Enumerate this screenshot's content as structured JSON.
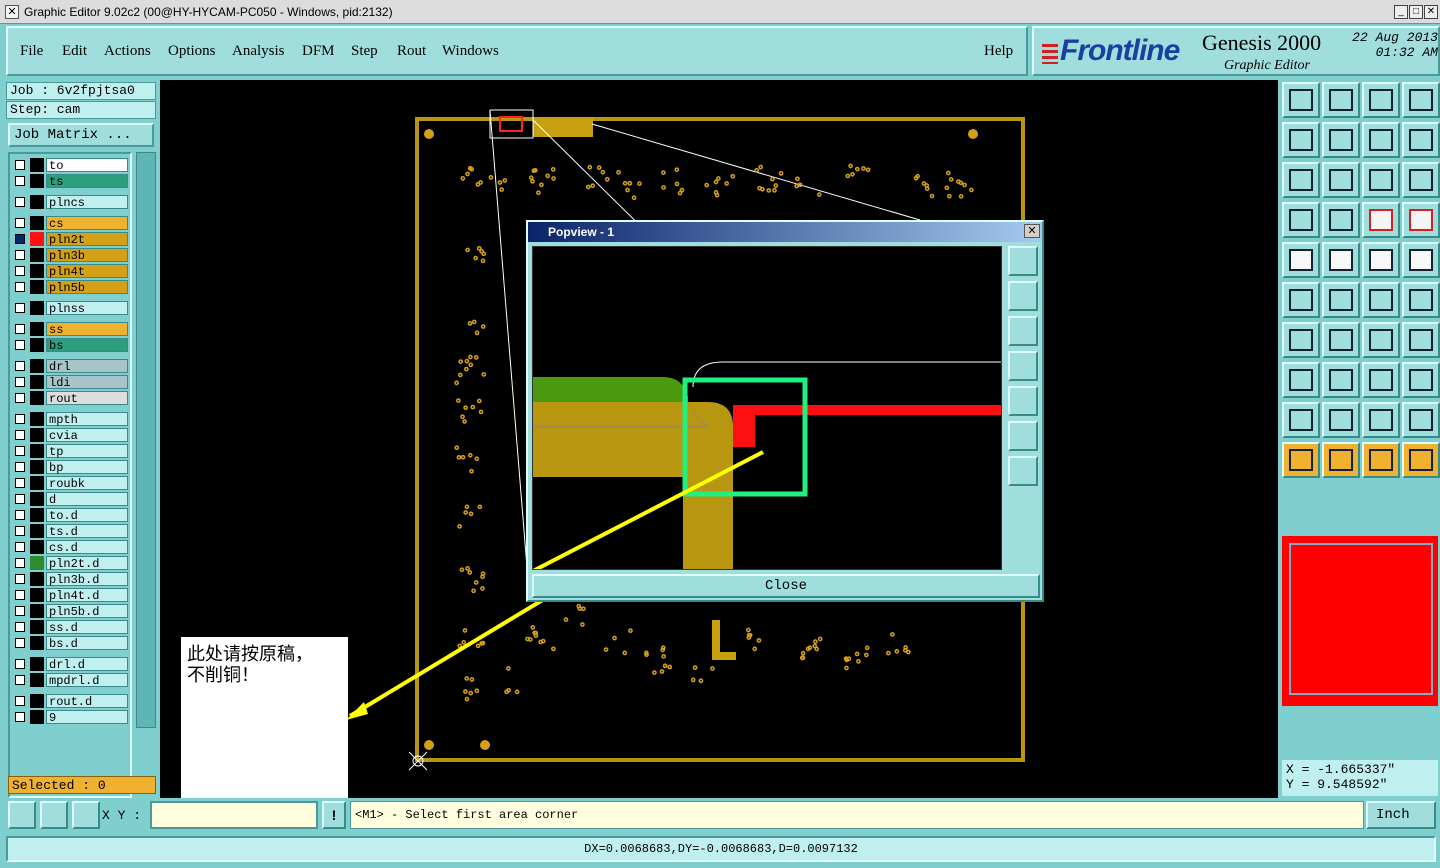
{
  "window": {
    "title": "Graphic Editor 9.02c2 (00@HY-HYCAM-PC050 - Windows, pid:2132)"
  },
  "menu": {
    "items": [
      "File",
      "Edit",
      "Actions",
      "Options",
      "Analysis",
      "DFM",
      "Step",
      "Rout",
      "Windows"
    ],
    "help": "Help"
  },
  "logo": {
    "brand": "Frontline",
    "product": "Genesis 2000",
    "subtitle": "Graphic Editor",
    "date": "22 Aug 2013",
    "time": "01:32 AM"
  },
  "job": {
    "job_label": "Job : 6v2fpjtsa0",
    "step_label": "Step: cam",
    "matrix_button": "Job Matrix ..."
  },
  "layers": [
    {
      "name": "to",
      "color": "#ffffff"
    },
    {
      "name": "ts",
      "color": "#2e9e7e"
    },
    {
      "name": "plncs",
      "color": "#bfefef"
    },
    {
      "name": "cs",
      "color": "#f0b030"
    },
    {
      "name": "pln2t",
      "color": "#d4a017",
      "active": true
    },
    {
      "name": "pln3b",
      "color": "#d4a017"
    },
    {
      "name": "pln4t",
      "color": "#d4a017"
    },
    {
      "name": "pln5b",
      "color": "#d4a017"
    },
    {
      "name": "plnss",
      "color": "#bfefef"
    },
    {
      "name": "ss",
      "color": "#f0b030"
    },
    {
      "name": "bs",
      "color": "#2e9e7e"
    },
    {
      "name": "drl",
      "color": "#a8c4c8"
    },
    {
      "name": "ldi",
      "color": "#a8c4c8"
    },
    {
      "name": "rout",
      "color": "#dddddd"
    },
    {
      "name": "mpth",
      "color": "#bfefef"
    },
    {
      "name": "cvia",
      "color": "#bfefef"
    },
    {
      "name": "tp",
      "color": "#bfefef"
    },
    {
      "name": "bp",
      "color": "#bfefef"
    },
    {
      "name": "roubk",
      "color": "#bfefef"
    },
    {
      "name": "d",
      "color": "#bfefef"
    },
    {
      "name": "to.d",
      "color": "#bfefef"
    },
    {
      "name": "ts.d",
      "color": "#bfefef"
    },
    {
      "name": "cs.d",
      "color": "#bfefef"
    },
    {
      "name": "pln2t.d",
      "color": "#bfefef",
      "marker": "#2e8b2e"
    },
    {
      "name": "pln3b.d",
      "color": "#bfefef"
    },
    {
      "name": "pln4t.d",
      "color": "#bfefef"
    },
    {
      "name": "pln5b.d",
      "color": "#bfefef"
    },
    {
      "name": "ss.d",
      "color": "#bfefef"
    },
    {
      "name": "bs.d",
      "color": "#bfefef"
    },
    {
      "name": "drl.d",
      "color": "#bfefef"
    },
    {
      "name": "mpdrl.d",
      "color": "#bfefef"
    },
    {
      "name": "rout.d",
      "color": "#bfefef"
    },
    {
      "name": "9",
      "color": "#bfefef"
    }
  ],
  "selected_label": "Selected : 0",
  "popview": {
    "title": "Popview - 1",
    "close_label": "Close"
  },
  "note": {
    "line1": "此处请按原稿，",
    "line2": "不削铜！"
  },
  "coords": {
    "x": "X = -1.665337\"",
    "y": "Y = 9.548592\""
  },
  "bottom": {
    "xy_label": "X Y :",
    "prompt": "<M1> - Select first area corner",
    "units": "Inch"
  },
  "status": "DX=0.0068683,DY=-0.0068683,D=0.0097132"
}
